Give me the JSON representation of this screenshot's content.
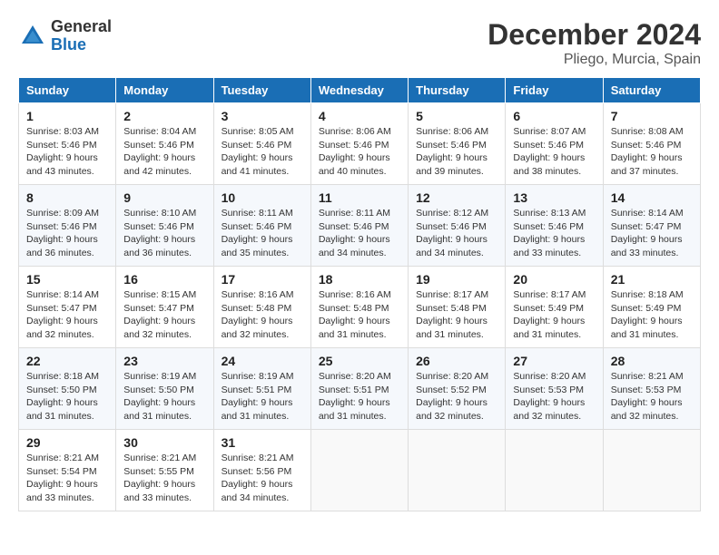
{
  "logo": {
    "general": "General",
    "blue": "Blue"
  },
  "title": {
    "month_year": "December 2024",
    "location": "Pliego, Murcia, Spain"
  },
  "weekdays": [
    "Sunday",
    "Monday",
    "Tuesday",
    "Wednesday",
    "Thursday",
    "Friday",
    "Saturday"
  ],
  "weeks": [
    [
      {
        "day": "1",
        "sunrise": "Sunrise: 8:03 AM",
        "sunset": "Sunset: 5:46 PM",
        "daylight": "Daylight: 9 hours and 43 minutes."
      },
      {
        "day": "2",
        "sunrise": "Sunrise: 8:04 AM",
        "sunset": "Sunset: 5:46 PM",
        "daylight": "Daylight: 9 hours and 42 minutes."
      },
      {
        "day": "3",
        "sunrise": "Sunrise: 8:05 AM",
        "sunset": "Sunset: 5:46 PM",
        "daylight": "Daylight: 9 hours and 41 minutes."
      },
      {
        "day": "4",
        "sunrise": "Sunrise: 8:06 AM",
        "sunset": "Sunset: 5:46 PM",
        "daylight": "Daylight: 9 hours and 40 minutes."
      },
      {
        "day": "5",
        "sunrise": "Sunrise: 8:06 AM",
        "sunset": "Sunset: 5:46 PM",
        "daylight": "Daylight: 9 hours and 39 minutes."
      },
      {
        "day": "6",
        "sunrise": "Sunrise: 8:07 AM",
        "sunset": "Sunset: 5:46 PM",
        "daylight": "Daylight: 9 hours and 38 minutes."
      },
      {
        "day": "7",
        "sunrise": "Sunrise: 8:08 AM",
        "sunset": "Sunset: 5:46 PM",
        "daylight": "Daylight: 9 hours and 37 minutes."
      }
    ],
    [
      {
        "day": "8",
        "sunrise": "Sunrise: 8:09 AM",
        "sunset": "Sunset: 5:46 PM",
        "daylight": "Daylight: 9 hours and 36 minutes."
      },
      {
        "day": "9",
        "sunrise": "Sunrise: 8:10 AM",
        "sunset": "Sunset: 5:46 PM",
        "daylight": "Daylight: 9 hours and 36 minutes."
      },
      {
        "day": "10",
        "sunrise": "Sunrise: 8:11 AM",
        "sunset": "Sunset: 5:46 PM",
        "daylight": "Daylight: 9 hours and 35 minutes."
      },
      {
        "day": "11",
        "sunrise": "Sunrise: 8:11 AM",
        "sunset": "Sunset: 5:46 PM",
        "daylight": "Daylight: 9 hours and 34 minutes."
      },
      {
        "day": "12",
        "sunrise": "Sunrise: 8:12 AM",
        "sunset": "Sunset: 5:46 PM",
        "daylight": "Daylight: 9 hours and 34 minutes."
      },
      {
        "day": "13",
        "sunrise": "Sunrise: 8:13 AM",
        "sunset": "Sunset: 5:46 PM",
        "daylight": "Daylight: 9 hours and 33 minutes."
      },
      {
        "day": "14",
        "sunrise": "Sunrise: 8:14 AM",
        "sunset": "Sunset: 5:47 PM",
        "daylight": "Daylight: 9 hours and 33 minutes."
      }
    ],
    [
      {
        "day": "15",
        "sunrise": "Sunrise: 8:14 AM",
        "sunset": "Sunset: 5:47 PM",
        "daylight": "Daylight: 9 hours and 32 minutes."
      },
      {
        "day": "16",
        "sunrise": "Sunrise: 8:15 AM",
        "sunset": "Sunset: 5:47 PM",
        "daylight": "Daylight: 9 hours and 32 minutes."
      },
      {
        "day": "17",
        "sunrise": "Sunrise: 8:16 AM",
        "sunset": "Sunset: 5:48 PM",
        "daylight": "Daylight: 9 hours and 32 minutes."
      },
      {
        "day": "18",
        "sunrise": "Sunrise: 8:16 AM",
        "sunset": "Sunset: 5:48 PM",
        "daylight": "Daylight: 9 hours and 31 minutes."
      },
      {
        "day": "19",
        "sunrise": "Sunrise: 8:17 AM",
        "sunset": "Sunset: 5:48 PM",
        "daylight": "Daylight: 9 hours and 31 minutes."
      },
      {
        "day": "20",
        "sunrise": "Sunrise: 8:17 AM",
        "sunset": "Sunset: 5:49 PM",
        "daylight": "Daylight: 9 hours and 31 minutes."
      },
      {
        "day": "21",
        "sunrise": "Sunrise: 8:18 AM",
        "sunset": "Sunset: 5:49 PM",
        "daylight": "Daylight: 9 hours and 31 minutes."
      }
    ],
    [
      {
        "day": "22",
        "sunrise": "Sunrise: 8:18 AM",
        "sunset": "Sunset: 5:50 PM",
        "daylight": "Daylight: 9 hours and 31 minutes."
      },
      {
        "day": "23",
        "sunrise": "Sunrise: 8:19 AM",
        "sunset": "Sunset: 5:50 PM",
        "daylight": "Daylight: 9 hours and 31 minutes."
      },
      {
        "day": "24",
        "sunrise": "Sunrise: 8:19 AM",
        "sunset": "Sunset: 5:51 PM",
        "daylight": "Daylight: 9 hours and 31 minutes."
      },
      {
        "day": "25",
        "sunrise": "Sunrise: 8:20 AM",
        "sunset": "Sunset: 5:51 PM",
        "daylight": "Daylight: 9 hours and 31 minutes."
      },
      {
        "day": "26",
        "sunrise": "Sunrise: 8:20 AM",
        "sunset": "Sunset: 5:52 PM",
        "daylight": "Daylight: 9 hours and 32 minutes."
      },
      {
        "day": "27",
        "sunrise": "Sunrise: 8:20 AM",
        "sunset": "Sunset: 5:53 PM",
        "daylight": "Daylight: 9 hours and 32 minutes."
      },
      {
        "day": "28",
        "sunrise": "Sunrise: 8:21 AM",
        "sunset": "Sunset: 5:53 PM",
        "daylight": "Daylight: 9 hours and 32 minutes."
      }
    ],
    [
      {
        "day": "29",
        "sunrise": "Sunrise: 8:21 AM",
        "sunset": "Sunset: 5:54 PM",
        "daylight": "Daylight: 9 hours and 33 minutes."
      },
      {
        "day": "30",
        "sunrise": "Sunrise: 8:21 AM",
        "sunset": "Sunset: 5:55 PM",
        "daylight": "Daylight: 9 hours and 33 minutes."
      },
      {
        "day": "31",
        "sunrise": "Sunrise: 8:21 AM",
        "sunset": "Sunset: 5:56 PM",
        "daylight": "Daylight: 9 hours and 34 minutes."
      },
      null,
      null,
      null,
      null
    ]
  ]
}
